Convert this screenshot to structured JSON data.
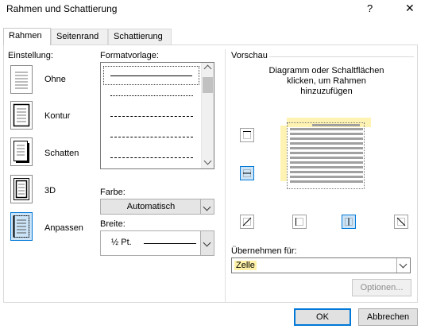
{
  "dialog": {
    "title": "Rahmen und Schattierung",
    "help": "?",
    "close": "✕"
  },
  "tabs": [
    {
      "label": "Rahmen",
      "active": true
    },
    {
      "label": "Seitenrand",
      "active": false
    },
    {
      "label": "Schattierung",
      "active": false
    }
  ],
  "settings": {
    "heading": "Einstellung:",
    "items": [
      {
        "label": "Ohne",
        "selected": false
      },
      {
        "label": "Kontur",
        "selected": false
      },
      {
        "label": "Schatten",
        "selected": false
      },
      {
        "label": "3D",
        "selected": false
      },
      {
        "label": "Anpassen",
        "selected": true
      }
    ]
  },
  "style": {
    "heading": "Formatvorlage:",
    "color_label": "Farbe:",
    "color_value": "Automatisch",
    "width_label": "Breite:",
    "width_value": "½ Pt."
  },
  "preview": {
    "heading": "Vorschau",
    "instruction_line1": "Diagramm oder Schaltflächen",
    "instruction_line2": "klicken, um Rahmen",
    "instruction_line3": "hinzuzufügen",
    "apply_label": "Übernehmen für:",
    "apply_value": "Zelle",
    "options_label": "Optionen..."
  },
  "footer": {
    "ok": "OK",
    "cancel": "Abbrechen"
  },
  "colors": {
    "accent": "#0078d7",
    "highlight": "#fff2a8"
  }
}
